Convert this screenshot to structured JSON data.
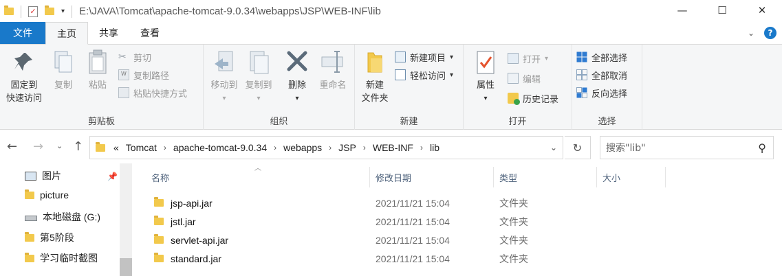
{
  "titlebar": {
    "path": "E:\\JAVA\\Tomcat\\apache-tomcat-9.0.34\\webapps\\JSP\\WEB-INF\\lib",
    "min": "—",
    "max": "☐",
    "close": "✕"
  },
  "tabs": {
    "file": "文件",
    "home": "主页",
    "share": "共享",
    "view": "查看"
  },
  "ribbon": {
    "clipboard": {
      "label": "剪贴板",
      "pin_line1": "固定到",
      "pin_line2": "快速访问",
      "copy": "复制",
      "paste": "粘贴",
      "cut": "剪切",
      "copy_path": "复制路径",
      "paste_shortcut": "粘贴快捷方式"
    },
    "organize": {
      "label": "组织",
      "move_to": "移动到",
      "copy_to": "复制到",
      "delete": "删除",
      "rename": "重命名"
    },
    "new": {
      "label": "新建",
      "new_folder_line1": "新建",
      "new_folder_line2": "文件夹",
      "new_item": "新建项目",
      "easy_access": "轻松访问"
    },
    "open": {
      "label": "打开",
      "properties": "属性",
      "open": "打开",
      "edit": "编辑",
      "history": "历史记录"
    },
    "select": {
      "label": "选择",
      "select_all": "全部选择",
      "select_none": "全部取消",
      "invert": "反向选择"
    }
  },
  "address": {
    "crumbs": [
      "Tomcat",
      "apache-tomcat-9.0.34",
      "webapps",
      "JSP",
      "WEB-INF",
      "lib"
    ],
    "overflow": "«",
    "search_placeholder": "搜索\"lib\""
  },
  "navpane": {
    "items": [
      {
        "label": "图片",
        "icon": "pictures-icon"
      },
      {
        "label": "picture",
        "icon": "folder-icon"
      },
      {
        "label": "本地磁盘 (G:)",
        "icon": "drive-icon"
      },
      {
        "label": "第5阶段",
        "icon": "folder-icon"
      },
      {
        "label": "学习临时截图",
        "icon": "folder-icon"
      }
    ]
  },
  "filelist": {
    "columns": {
      "name": "名称",
      "date": "修改日期",
      "type": "类型",
      "size": "大小"
    },
    "rows": [
      {
        "name": "jsp-api.jar",
        "date": "2021/11/21 15:04",
        "type": "文件夹"
      },
      {
        "name": "jstl.jar",
        "date": "2021/11/21 15:04",
        "type": "文件夹"
      },
      {
        "name": "servlet-api.jar",
        "date": "2021/11/21 15:04",
        "type": "文件夹"
      },
      {
        "name": "standard.jar",
        "date": "2021/11/21 15:04",
        "type": "文件夹"
      }
    ]
  },
  "colors": {
    "accent": "#1979ca",
    "folder": "#f2c94c",
    "header_text": "#4c607a"
  }
}
